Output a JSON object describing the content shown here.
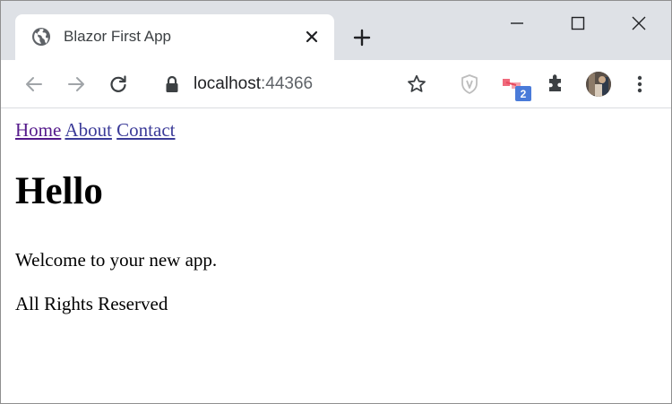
{
  "browser": {
    "tab": {
      "title": "Blazor First App",
      "favicon": "globe-icon",
      "close_icon": "close-icon"
    },
    "new_tab_icon": "plus-icon",
    "window_controls": [
      "minimize-icon",
      "maximize-icon",
      "close-icon"
    ],
    "toolbar": {
      "back_icon": "arrow-left-icon",
      "forward_icon": "arrow-right-icon",
      "reload_icon": "reload-icon",
      "lock_icon": "lock-icon",
      "url_host": "localhost",
      "url_port": ":44366",
      "bookmark_icon": "star-icon",
      "extensions": [
        {
          "icon": "shield-icon"
        },
        {
          "icon": "cast-extension-icon",
          "badge": "2"
        },
        {
          "icon": "puzzle-icon"
        }
      ],
      "menu_icon": "kebab-menu-icon"
    }
  },
  "page": {
    "nav_links": [
      "Home",
      "About",
      "Contact"
    ],
    "heading": "Hello",
    "body_text": "Welcome to your new app.",
    "footer": "All Rights Reserved"
  },
  "colors": {
    "titlebar_bg": "#dee1e6",
    "link": "#3b3b98",
    "visited_link": "#551a8b",
    "badge": "#4a7bd9"
  }
}
